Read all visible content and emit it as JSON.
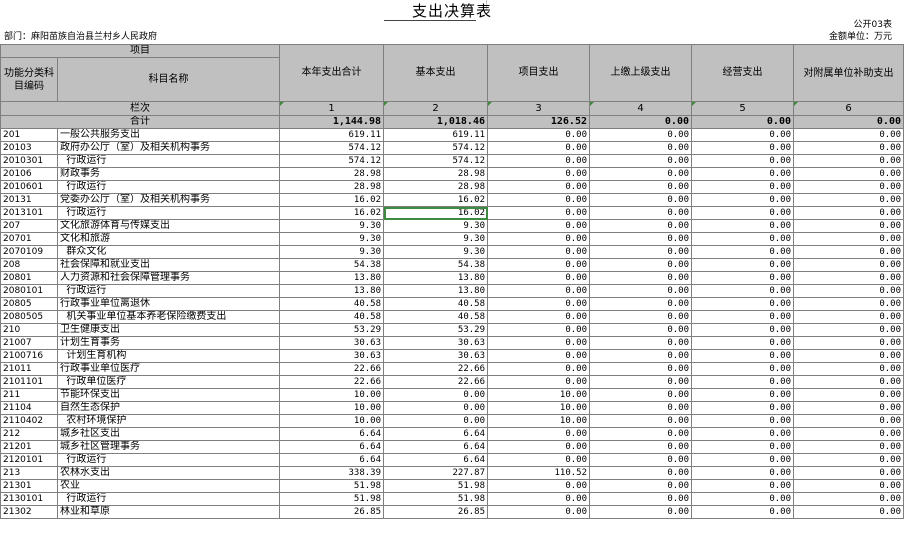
{
  "title": "支出决算表",
  "table_code": "公开03表",
  "department": "部门：麻阳苗族自治县兰村乡人民政府",
  "unit": "金额单位：万元",
  "headers": {
    "group": "项目",
    "code": "功能分类科目编码",
    "name": "科目名称",
    "col1": "本年支出合计",
    "col2": "基本支出",
    "col3": "项目支出",
    "col4": "上缴上级支出",
    "col5": "经营支出",
    "col6": "对附属单位补助支出"
  },
  "column_index": {
    "label": "栏次",
    "values": [
      "1",
      "2",
      "3",
      "4",
      "5",
      "6"
    ]
  },
  "total": {
    "label": "合计",
    "values": [
      "1,144.98",
      "1,018.46",
      "126.52",
      "0.00",
      "0.00",
      "0.00"
    ]
  },
  "rows": [
    {
      "code": "201",
      "name": "一般公共服务支出",
      "v": [
        "619.11",
        "619.11",
        "0.00",
        "0.00",
        "0.00",
        "0.00"
      ]
    },
    {
      "code": "20103",
      "name": "政府办公厅（室）及相关机构事务",
      "v": [
        "574.12",
        "574.12",
        "0.00",
        "0.00",
        "0.00",
        "0.00"
      ]
    },
    {
      "code": "2010301",
      "name": "  行政运行",
      "v": [
        "574.12",
        "574.12",
        "0.00",
        "0.00",
        "0.00",
        "0.00"
      ]
    },
    {
      "code": "20106",
      "name": "财政事务",
      "v": [
        "28.98",
        "28.98",
        "0.00",
        "0.00",
        "0.00",
        "0.00"
      ]
    },
    {
      "code": "2010601",
      "name": "  行政运行",
      "v": [
        "28.98",
        "28.98",
        "0.00",
        "0.00",
        "0.00",
        "0.00"
      ]
    },
    {
      "code": "20131",
      "name": "党委办公厅（室）及相关机构事务",
      "v": [
        "16.02",
        "16.02",
        "0.00",
        "0.00",
        "0.00",
        "0.00"
      ]
    },
    {
      "code": "2013101",
      "name": "  行政运行",
      "v": [
        "16.02",
        "16.02",
        "0.00",
        "0.00",
        "0.00",
        "0.00"
      ]
    },
    {
      "code": "207",
      "name": "文化旅游体育与传媒支出",
      "v": [
        "9.30",
        "9.30",
        "0.00",
        "0.00",
        "0.00",
        "0.00"
      ]
    },
    {
      "code": "20701",
      "name": "文化和旅游",
      "v": [
        "9.30",
        "9.30",
        "0.00",
        "0.00",
        "0.00",
        "0.00"
      ]
    },
    {
      "code": "2070109",
      "name": "  群众文化",
      "v": [
        "9.30",
        "9.30",
        "0.00",
        "0.00",
        "0.00",
        "0.00"
      ]
    },
    {
      "code": "208",
      "name": "社会保障和就业支出",
      "v": [
        "54.38",
        "54.38",
        "0.00",
        "0.00",
        "0.00",
        "0.00"
      ]
    },
    {
      "code": "20801",
      "name": "人力资源和社会保障管理事务",
      "v": [
        "13.80",
        "13.80",
        "0.00",
        "0.00",
        "0.00",
        "0.00"
      ]
    },
    {
      "code": "2080101",
      "name": "  行政运行",
      "v": [
        "13.80",
        "13.80",
        "0.00",
        "0.00",
        "0.00",
        "0.00"
      ]
    },
    {
      "code": "20805",
      "name": "行政事业单位离退休",
      "v": [
        "40.58",
        "40.58",
        "0.00",
        "0.00",
        "0.00",
        "0.00"
      ]
    },
    {
      "code": "2080505",
      "name": "  机关事业单位基本养老保险缴费支出",
      "v": [
        "40.58",
        "40.58",
        "0.00",
        "0.00",
        "0.00",
        "0.00"
      ]
    },
    {
      "code": "210",
      "name": "卫生健康支出",
      "v": [
        "53.29",
        "53.29",
        "0.00",
        "0.00",
        "0.00",
        "0.00"
      ]
    },
    {
      "code": "21007",
      "name": "计划生育事务",
      "v": [
        "30.63",
        "30.63",
        "0.00",
        "0.00",
        "0.00",
        "0.00"
      ]
    },
    {
      "code": "2100716",
      "name": "  计划生育机构",
      "v": [
        "30.63",
        "30.63",
        "0.00",
        "0.00",
        "0.00",
        "0.00"
      ]
    },
    {
      "code": "21011",
      "name": "行政事业单位医疗",
      "v": [
        "22.66",
        "22.66",
        "0.00",
        "0.00",
        "0.00",
        "0.00"
      ]
    },
    {
      "code": "2101101",
      "name": "  行政单位医疗",
      "v": [
        "22.66",
        "22.66",
        "0.00",
        "0.00",
        "0.00",
        "0.00"
      ]
    },
    {
      "code": "211",
      "name": "节能环保支出",
      "v": [
        "10.00",
        "0.00",
        "10.00",
        "0.00",
        "0.00",
        "0.00"
      ]
    },
    {
      "code": "21104",
      "name": "自然生态保护",
      "v": [
        "10.00",
        "0.00",
        "10.00",
        "0.00",
        "0.00",
        "0.00"
      ]
    },
    {
      "code": "2110402",
      "name": "  农村环境保护",
      "v": [
        "10.00",
        "0.00",
        "10.00",
        "0.00",
        "0.00",
        "0.00"
      ]
    },
    {
      "code": "212",
      "name": "城乡社区支出",
      "v": [
        "6.64",
        "6.64",
        "0.00",
        "0.00",
        "0.00",
        "0.00"
      ]
    },
    {
      "code": "21201",
      "name": "城乡社区管理事务",
      "v": [
        "6.64",
        "6.64",
        "0.00",
        "0.00",
        "0.00",
        "0.00"
      ]
    },
    {
      "code": "2120101",
      "name": "  行政运行",
      "v": [
        "6.64",
        "6.64",
        "0.00",
        "0.00",
        "0.00",
        "0.00"
      ]
    },
    {
      "code": "213",
      "name": "农林水支出",
      "v": [
        "338.39",
        "227.87",
        "110.52",
        "0.00",
        "0.00",
        "0.00"
      ]
    },
    {
      "code": "21301",
      "name": "农业",
      "v": [
        "51.98",
        "51.98",
        "0.00",
        "0.00",
        "0.00",
        "0.00"
      ]
    },
    {
      "code": "2130101",
      "name": "  行政运行",
      "v": [
        "51.98",
        "51.98",
        "0.00",
        "0.00",
        "0.00",
        "0.00"
      ]
    },
    {
      "code": "21302",
      "name": "林业和草原",
      "v": [
        "26.85",
        "26.85",
        "0.00",
        "0.00",
        "0.00",
        "0.00"
      ]
    }
  ]
}
